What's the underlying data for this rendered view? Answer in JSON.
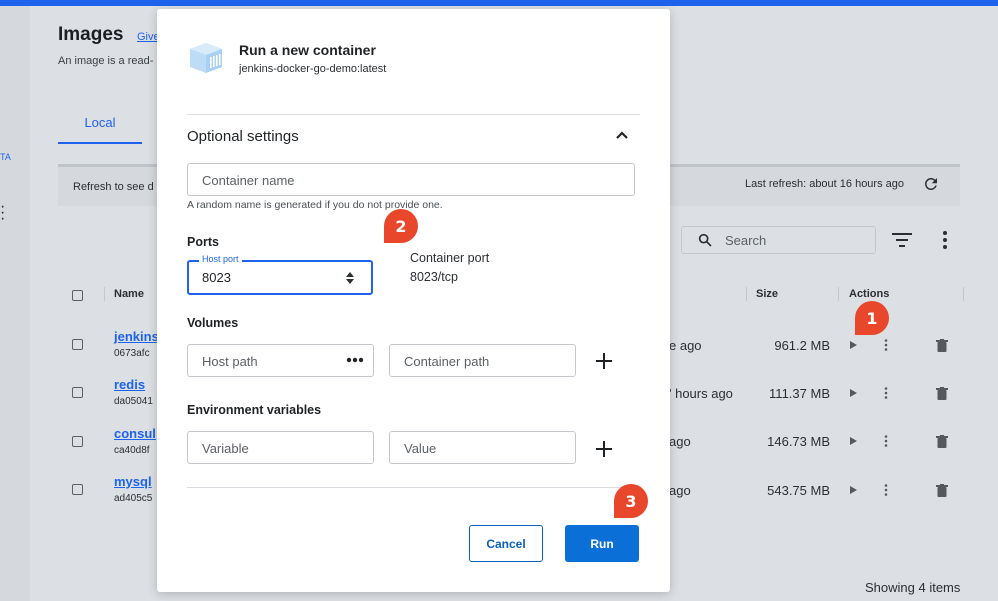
{
  "app": {
    "page_title": "Images",
    "give_feedback_link": "Give",
    "description": "An image is a read-",
    "nav_beta": "TA",
    "tab_local": "Local",
    "refresh_text": "Refresh to see d",
    "last_refresh": "Last refresh: about 16 hours ago",
    "search_placeholder": "Search",
    "columns": {
      "name": "Name",
      "size": "Size",
      "actions": "Actions"
    },
    "rows": [
      {
        "name": "jenkins",
        "id": "0673afc",
        "created": "e ago",
        "size": "961.2 MB"
      },
      {
        "name": "redis",
        "id": "da05041",
        "created": "' hours ago",
        "size": "111.37 MB"
      },
      {
        "name": "consul",
        "id": "ca40d8f",
        "created": "ago",
        "size": "146.73 MB"
      },
      {
        "name": "mysql",
        "id": "ad405c5",
        "created": "ago",
        "size": "543.75 MB"
      }
    ],
    "footer": "Showing 4 items"
  },
  "callouts": [
    "1",
    "2",
    "3"
  ],
  "modal": {
    "title": "Run a new container",
    "subtitle": "jenkins-docker-go-demo:latest",
    "section_title": "Optional settings",
    "container_name_placeholder": "Container name",
    "container_name_hint": "A random name is generated if you do not provide one.",
    "ports_label": "Ports",
    "host_port_label": "Host port",
    "host_port_value": "8023",
    "container_port_label": "Container port",
    "container_port_value": "8023/tcp",
    "volumes_label": "Volumes",
    "host_path_placeholder": "Host path",
    "container_path_placeholder": "Container path",
    "env_label": "Environment variables",
    "variable_placeholder": "Variable",
    "value_placeholder": "Value",
    "cancel_label": "Cancel",
    "run_label": "Run"
  },
  "colors": {
    "accent": "#1d63ed",
    "run_button": "#0b6fd8",
    "callout": "#e8472b"
  }
}
